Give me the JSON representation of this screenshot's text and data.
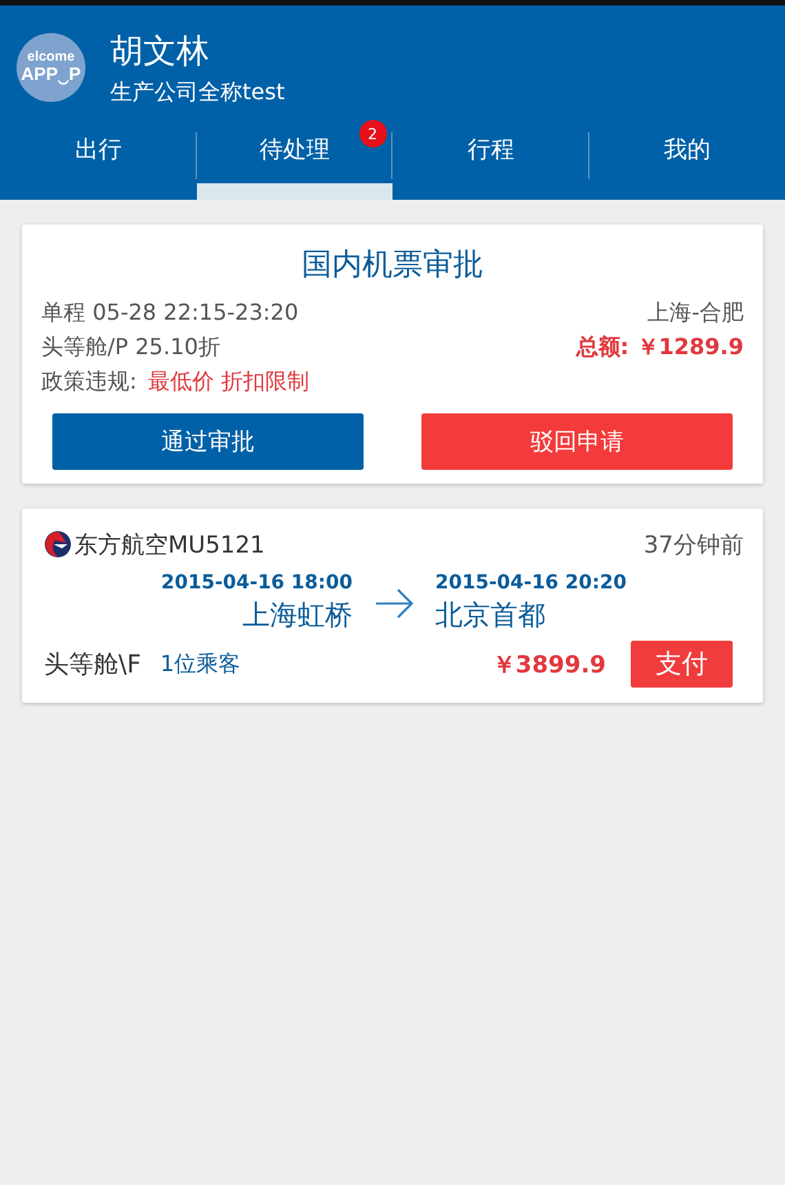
{
  "header": {
    "avatar": {
      "line_1": "elcome",
      "line_2": "APP‿P"
    },
    "name": "胡文林",
    "company": "生产公司全称test"
  },
  "tabs": [
    {
      "label": "出行",
      "selected": false
    },
    {
      "label": "待处理",
      "selected": true,
      "badge": "2"
    },
    {
      "label": "行程",
      "selected": false
    },
    {
      "label": "我的",
      "selected": false
    }
  ],
  "approval": {
    "title": "国内机票审批",
    "trip": "单程 05-28 22:15-23:20",
    "route": "上海-合肥",
    "cabin": "头等舱/P 25.10折",
    "total": "总额: ￥1289.9",
    "policy_label": "政策违规:",
    "violations": "最低价 折扣限制",
    "approve": "通过审批",
    "reject": "驳回申请"
  },
  "order": {
    "airline": "东方航空MU5121",
    "time_ago": "37分钟前",
    "depart_time": "2015-04-16 18:00",
    "depart_airport": "上海虹桥",
    "arrive_time": "2015-04-16 20:20",
    "arrive_airport": "北京首都",
    "cabin": "头等舱\\F",
    "passengers": "1位乘客",
    "price": "￥3899.9",
    "pay": "支付"
  }
}
